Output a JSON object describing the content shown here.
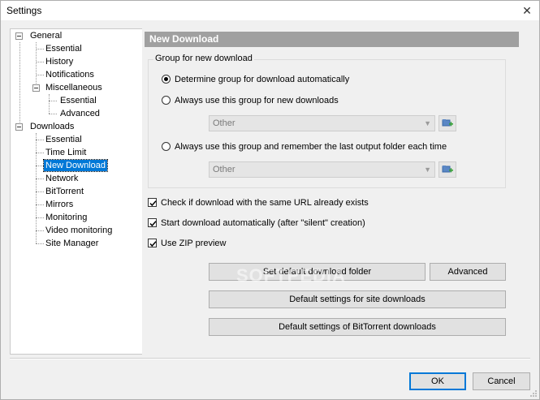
{
  "window": {
    "title": "Settings",
    "close_glyph": "✕"
  },
  "tree": {
    "items": [
      {
        "label": "General"
      },
      {
        "label": "Essential"
      },
      {
        "label": "History"
      },
      {
        "label": "Notifications"
      },
      {
        "label": "Miscellaneous"
      },
      {
        "label": "Essential"
      },
      {
        "label": "Advanced"
      },
      {
        "label": "Downloads"
      },
      {
        "label": "Essential"
      },
      {
        "label": "Time Limit"
      },
      {
        "label": "New Download"
      },
      {
        "label": "Network"
      },
      {
        "label": "BitTorrent"
      },
      {
        "label": "Mirrors"
      },
      {
        "label": "Monitoring"
      },
      {
        "label": "Video monitoring"
      },
      {
        "label": "Site Manager"
      }
    ],
    "selected": "New Download"
  },
  "panel": {
    "header": "New Download",
    "group": {
      "label": "Group for new download",
      "options": [
        {
          "label": "Determine group for download automatically",
          "checked": true
        },
        {
          "label": "Always use this group for new downloads",
          "checked": false
        },
        {
          "label": "Always use this group and remember the last output folder each time",
          "checked": false
        }
      ],
      "select1": {
        "value": "Other"
      },
      "select2": {
        "value": "Other"
      }
    },
    "checks": [
      {
        "label": "Check if download with the same URL already exists",
        "checked": true
      },
      {
        "label": "Start download automatically (after \"silent\" creation)",
        "checked": true
      },
      {
        "label": "Use ZIP preview",
        "checked": true
      }
    ],
    "buttons": {
      "default_folder": "Set default download folder",
      "advanced": "Advanced",
      "site_defaults": "Default settings for site downloads",
      "bittorrent_defaults": "Default settings of BitTorrent downloads"
    }
  },
  "footer": {
    "ok": "OK",
    "cancel": "Cancel"
  },
  "watermark": "SOFTPEDIA",
  "colors": {
    "selection": "#0078d7",
    "header_bg": "#a0a0a0"
  }
}
